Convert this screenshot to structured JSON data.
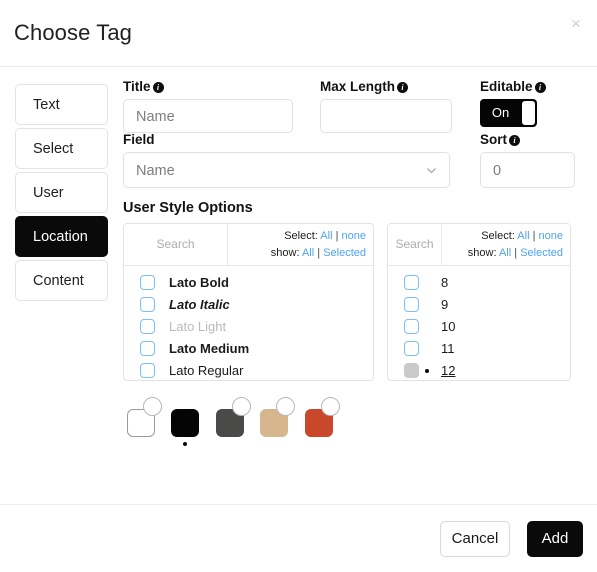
{
  "dialog": {
    "title": "Choose Tag",
    "close_icon": "close-icon"
  },
  "tabs": [
    {
      "label": "Text",
      "active": false
    },
    {
      "label": "Select",
      "active": false
    },
    {
      "label": "User",
      "active": false
    },
    {
      "label": "Location",
      "active": true
    },
    {
      "label": "Content",
      "active": false
    }
  ],
  "fields": {
    "title": {
      "label": "Title",
      "info_icon": "info-icon",
      "value": "",
      "placeholder": "Name"
    },
    "max_length": {
      "label": "Max Length",
      "info_icon": "info-icon",
      "value": "",
      "placeholder": ""
    },
    "editable": {
      "label": "Editable",
      "info_icon": "info-icon",
      "state_label": "On",
      "on": true
    },
    "field": {
      "label": "Field",
      "value": "Name",
      "chevron_icon": "chevron-down-icon"
    },
    "sort": {
      "label": "Sort",
      "info_icon": "info-icon",
      "value": "",
      "placeholder": "0"
    }
  },
  "user_style_options": {
    "heading": "User Style Options",
    "panels": [
      {
        "name": "font-panel",
        "search_placeholder": "Search",
        "select_label": "Select:",
        "select_all": "All",
        "select_none": "none",
        "show_label": "show:",
        "show_all": "All",
        "show_selected": "Selected",
        "separator": "|",
        "options": [
          {
            "label": "Lato Bold",
            "style": "w-bold",
            "checked": false,
            "marked": false
          },
          {
            "label": "Lato Italic",
            "style": "w-italic",
            "checked": false,
            "marked": false
          },
          {
            "label": "Lato Light",
            "style": "w-light",
            "checked": false,
            "marked": false
          },
          {
            "label": "Lato Medium",
            "style": "w-medium",
            "checked": false,
            "marked": false
          },
          {
            "label": "Lato Regular",
            "style": "w-regular",
            "checked": false,
            "marked": false
          }
        ]
      },
      {
        "name": "size-panel",
        "search_placeholder": "Search",
        "select_label": "Select:",
        "select_all": "All",
        "select_none": "none",
        "show_label": "show:",
        "show_all": "All",
        "show_selected": "Selected",
        "separator": "|",
        "options": [
          {
            "label": "8",
            "style": "",
            "checked": false,
            "marked": false
          },
          {
            "label": "9",
            "style": "",
            "checked": false,
            "marked": false
          },
          {
            "label": "10",
            "style": "",
            "checked": false,
            "marked": false
          },
          {
            "label": "11",
            "style": "",
            "checked": false,
            "marked": false
          },
          {
            "label": "12",
            "style": "underline",
            "checked": true,
            "marked": true
          }
        ]
      }
    ]
  },
  "color_swatches": [
    {
      "name": "swatch-white",
      "color": "#ffffff",
      "bordered": true,
      "badge": true,
      "selected": false
    },
    {
      "name": "swatch-black",
      "color": "#050505",
      "bordered": false,
      "badge": false,
      "selected": true
    },
    {
      "name": "swatch-dark-gray",
      "color": "#4a4a48",
      "bordered": false,
      "badge": true,
      "selected": false
    },
    {
      "name": "swatch-tan",
      "color": "#d6b68d",
      "bordered": false,
      "badge": true,
      "selected": false
    },
    {
      "name": "swatch-rust",
      "color": "#c9472a",
      "bordered": false,
      "badge": true,
      "selected": false
    }
  ],
  "footer": {
    "cancel_label": "Cancel",
    "add_label": "Add"
  },
  "colors": {
    "accent_link": "#4da3f0",
    "checkbox_border": "#7cc0f5",
    "active_tab_bg": "#0a0a0a"
  }
}
